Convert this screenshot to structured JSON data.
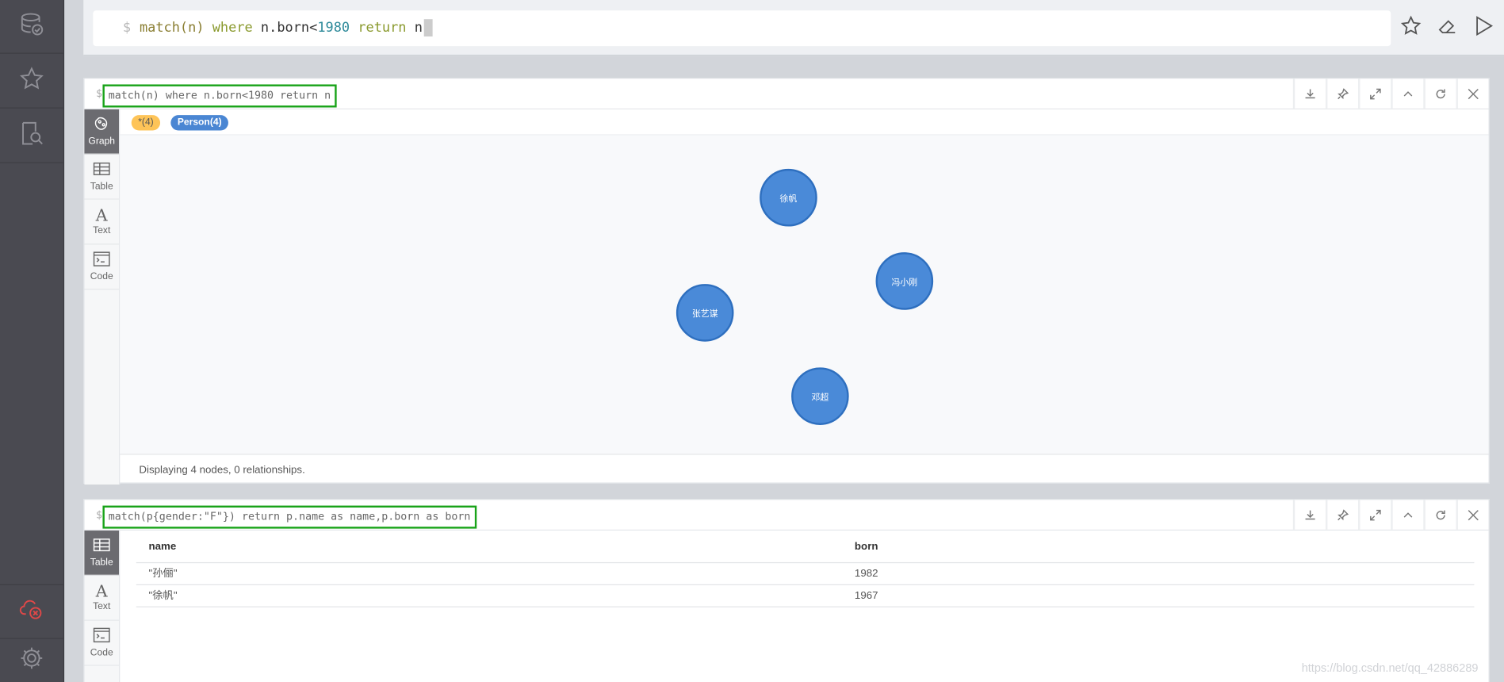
{
  "sidebar": {
    "icons": [
      "database-icon",
      "star-icon",
      "search-document-icon",
      "disconnected-cloud-icon",
      "gear-icon"
    ]
  },
  "editor": {
    "prompt": "$",
    "query_parts": [
      "match(n)",
      " where ",
      "n.born<",
      "1980",
      " return ",
      "n"
    ]
  },
  "frame1": {
    "prompt": "$",
    "query": "match(n) where n.born<1980 return n",
    "tabs": [
      "Graph",
      "Table",
      "Text",
      "Code"
    ],
    "legend": {
      "all": "*(4)",
      "person": "Person(4)"
    },
    "nodes": [
      "徐帆",
      "冯小刚",
      "张艺谋",
      "邓超"
    ],
    "status": "Displaying 4 nodes, 0 relationships."
  },
  "frame2": {
    "prompt": "$",
    "query": "match(p{gender:\"F\"}) return p.name as name,p.born as born",
    "tabs": [
      "Table",
      "Text",
      "Code"
    ],
    "columns": [
      "name",
      "born"
    ],
    "rows": [
      [
        "\"孙俪\"",
        "1982"
      ],
      [
        "\"徐帆\"",
        "1967"
      ]
    ]
  },
  "watermark": "https://blog.csdn.net/qq_42886289",
  "colors": {
    "accent_green": "#19a319",
    "node_blue": "#4a8ad8",
    "sidebar": "#4a4a51"
  }
}
